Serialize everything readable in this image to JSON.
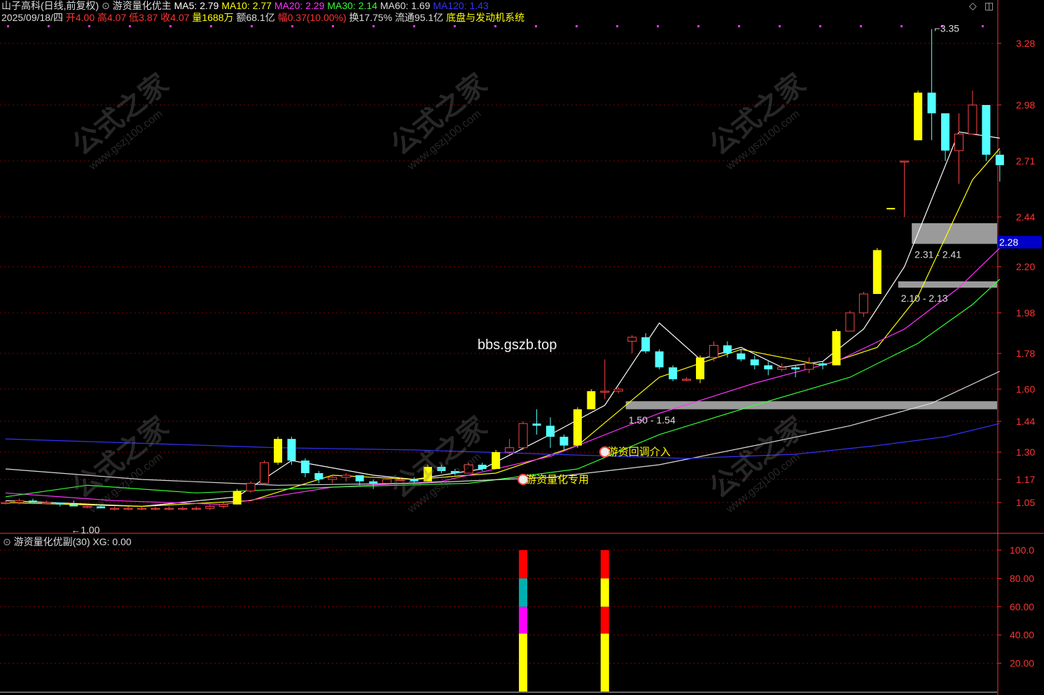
{
  "header": {
    "stock": "山子高科(日线,前复权)",
    "indicator": "游资量化优主",
    "ma": [
      {
        "label": "MA5: 2.79",
        "color": "#ffffff"
      },
      {
        "label": "MA10: 2.77",
        "color": "#ffff00"
      },
      {
        "label": "MA20: 2.29",
        "color": "#ff33ff"
      },
      {
        "label": "MA30: 2.14",
        "color": "#33ff33"
      },
      {
        "label": "MA60: 1.69",
        "color": "#dddddd"
      },
      {
        "label": "MA120: 1.43",
        "color": "#3333ff"
      }
    ],
    "date": "2025/09/18/四",
    "open": "开4.00",
    "high": "高4.07",
    "low": "低3.87",
    "close": "收4.07",
    "volume": "量1688万",
    "amount": "额68.1亿",
    "change": "幅0.37(10.00%)",
    "turnover": "换17.75%",
    "float_cap": "流通95.1亿",
    "system": "底盘与发动机系统"
  },
  "watermark": {
    "cn": "公式之家",
    "url": "www.gszj100.com"
  },
  "site_text": "bbs.gszb.top",
  "price_tag": "2.28",
  "sub_header": {
    "name": "游资量化优副(30)",
    "xg": "XG: 0.00"
  },
  "colors": {
    "up": "#ff4444",
    "down": "#54ffff",
    "signal": "#ffff00",
    "grid": "#8b0000",
    "axis": "#ff3333"
  },
  "chart_data": {
    "type": "candlestick",
    "y_ticks": [
      3.28,
      2.98,
      2.71,
      2.44,
      2.2,
      1.98,
      1.78,
      1.6,
      1.44,
      1.3,
      1.17,
      1.05
    ],
    "y_tick_labels": [
      "3.28",
      "2.98",
      "2.71",
      "2.44",
      "2.20",
      "1.98",
      "1.78",
      "1.60",
      "1.44",
      "1.30",
      "1.17",
      "1.05"
    ],
    "sub_ticks": [
      100,
      80,
      60,
      40,
      20
    ],
    "sub_tick_labels": [
      "100.0",
      "80.00",
      "60.00",
      "40.00",
      "20.00"
    ],
    "candles": [
      [
        1.05,
        1.06,
        1.04,
        1.05
      ],
      [
        1.05,
        1.07,
        1.04,
        1.06
      ],
      [
        1.06,
        1.07,
        1.05,
        1.05
      ],
      [
        1.05,
        1.06,
        1.04,
        1.05
      ],
      [
        1.05,
        1.05,
        1.03,
        1.04
      ],
      [
        1.04,
        1.06,
        1.03,
        1.03
      ],
      [
        1.03,
        1.04,
        1.02,
        1.03
      ],
      [
        1.03,
        1.04,
        1.02,
        1.02
      ],
      [
        1.02,
        1.03,
        1.01,
        1.02
      ],
      [
        1.02,
        1.03,
        1.01,
        1.02
      ],
      [
        1.02,
        1.03,
        1.01,
        1.02
      ],
      [
        1.02,
        1.03,
        1.01,
        1.02
      ],
      [
        1.02,
        1.03,
        1.01,
        1.02
      ],
      [
        1.02,
        1.03,
        1.01,
        1.02
      ],
      [
        1.02,
        1.03,
        1.01,
        1.02
      ],
      [
        1.02,
        1.04,
        1.01,
        1.03
      ],
      [
        1.03,
        1.05,
        1.02,
        1.04
      ],
      [
        1.04,
        1.12,
        1.04,
        1.11
      ],
      [
        1.11,
        1.16,
        1.1,
        1.15
      ],
      [
        1.15,
        1.26,
        1.14,
        1.25
      ],
      [
        1.25,
        1.37,
        1.24,
        1.36
      ],
      [
        1.36,
        1.37,
        1.24,
        1.26
      ],
      [
        1.26,
        1.27,
        1.18,
        1.2
      ],
      [
        1.2,
        1.21,
        1.15,
        1.17
      ],
      [
        1.17,
        1.19,
        1.15,
        1.18
      ],
      [
        1.18,
        1.2,
        1.16,
        1.19
      ],
      [
        1.19,
        1.19,
        1.14,
        1.16
      ],
      [
        1.16,
        1.17,
        1.12,
        1.15
      ],
      [
        1.15,
        1.18,
        1.14,
        1.17
      ],
      [
        1.17,
        1.18,
        1.16,
        1.17
      ],
      [
        1.17,
        1.18,
        1.15,
        1.16
      ],
      [
        1.16,
        1.24,
        1.16,
        1.23
      ],
      [
        1.23,
        1.24,
        1.2,
        1.21
      ],
      [
        1.21,
        1.22,
        1.19,
        1.2
      ],
      [
        1.2,
        1.25,
        1.2,
        1.24
      ],
      [
        1.24,
        1.25,
        1.21,
        1.22
      ],
      [
        1.22,
        1.31,
        1.22,
        1.3
      ],
      [
        1.3,
        1.36,
        1.29,
        1.32
      ],
      [
        1.32,
        1.44,
        1.31,
        1.43
      ],
      [
        1.43,
        1.5,
        1.38,
        1.42
      ],
      [
        1.42,
        1.46,
        1.32,
        1.37
      ],
      [
        1.37,
        1.38,
        1.31,
        1.33
      ],
      [
        1.33,
        1.51,
        1.32,
        1.5
      ],
      [
        1.5,
        1.6,
        1.5,
        1.59
      ],
      [
        1.59,
        1.75,
        1.55,
        1.59
      ],
      [
        1.59,
        1.61,
        1.58,
        1.6
      ],
      [
        1.84,
        1.87,
        1.78,
        1.86
      ],
      [
        1.86,
        1.88,
        1.78,
        1.79
      ],
      [
        1.79,
        1.8,
        1.7,
        1.71
      ],
      [
        1.71,
        1.72,
        1.64,
        1.65
      ],
      [
        1.65,
        1.66,
        1.64,
        1.65
      ],
      [
        1.65,
        1.77,
        1.63,
        1.76
      ],
      [
        1.76,
        1.84,
        1.74,
        1.82
      ],
      [
        1.82,
        1.84,
        1.76,
        1.78
      ],
      [
        1.78,
        1.8,
        1.74,
        1.75
      ],
      [
        1.75,
        1.77,
        1.7,
        1.72
      ],
      [
        1.72,
        1.74,
        1.67,
        1.7
      ],
      [
        1.7,
        1.73,
        1.69,
        1.71
      ],
      [
        1.71,
        1.72,
        1.66,
        1.7
      ],
      [
        1.7,
        1.76,
        1.68,
        1.73
      ],
      [
        1.73,
        1.74,
        1.7,
        1.72
      ],
      [
        1.72,
        1.9,
        1.72,
        1.89
      ],
      [
        1.89,
        1.99,
        1.89,
        1.98
      ],
      [
        1.98,
        2.08,
        1.96,
        2.07
      ],
      [
        2.07,
        2.29,
        2.07,
        2.28
      ],
      [
        2.48,
        2.48,
        2.48,
        2.48
      ],
      [
        2.71,
        2.71,
        2.44,
        2.71
      ],
      [
        2.81,
        3.05,
        2.81,
        3.04
      ],
      [
        3.04,
        3.35,
        2.81,
        2.94
      ],
      [
        2.94,
        2.94,
        2.71,
        2.76
      ],
      [
        2.76,
        2.94,
        2.6,
        2.84
      ],
      [
        2.84,
        3.05,
        2.84,
        2.98
      ],
      [
        2.98,
        2.98,
        2.71,
        2.74
      ],
      [
        2.74,
        2.76,
        2.61,
        2.69
      ]
    ],
    "ma_series": [
      {
        "name": "MA5",
        "color": "#ffffff",
        "values": [
          [
            0,
            1.06
          ],
          [
            10,
            1.03
          ],
          [
            17,
            1.08
          ],
          [
            21,
            1.26
          ],
          [
            27,
            1.19
          ],
          [
            30,
            1.17
          ],
          [
            35,
            1.22
          ],
          [
            40,
            1.38
          ],
          [
            44,
            1.52
          ],
          [
            48,
            1.93
          ],
          [
            51,
            1.75
          ],
          [
            54,
            1.81
          ],
          [
            57,
            1.71
          ],
          [
            60,
            1.74
          ],
          [
            63,
            1.9
          ],
          [
            66,
            2.2
          ],
          [
            70,
            2.85
          ],
          [
            73,
            2.82
          ]
        ]
      },
      {
        "name": "MA10",
        "color": "#ffff00",
        "values": [
          [
            0,
            1.05
          ],
          [
            10,
            1.03
          ],
          [
            18,
            1.06
          ],
          [
            24,
            1.19
          ],
          [
            30,
            1.17
          ],
          [
            36,
            1.2
          ],
          [
            42,
            1.33
          ],
          [
            48,
            1.66
          ],
          [
            54,
            1.8
          ],
          [
            60,
            1.72
          ],
          [
            64,
            1.81
          ],
          [
            67,
            2.06
          ],
          [
            71,
            2.62
          ],
          [
            73,
            2.77
          ]
        ]
      },
      {
        "name": "MA20",
        "color": "#ff33ff",
        "values": [
          [
            0,
            1.1
          ],
          [
            8,
            1.06
          ],
          [
            16,
            1.04
          ],
          [
            24,
            1.13
          ],
          [
            32,
            1.16
          ],
          [
            40,
            1.28
          ],
          [
            48,
            1.48
          ],
          [
            55,
            1.63
          ],
          [
            61,
            1.74
          ],
          [
            66,
            1.9
          ],
          [
            70,
            2.1
          ],
          [
            73,
            2.29
          ]
        ]
      },
      {
        "name": "MA30",
        "color": "#33ff33",
        "values": [
          [
            0,
            1.08
          ],
          [
            6,
            1.14
          ],
          [
            14,
            1.1
          ],
          [
            24,
            1.13
          ],
          [
            34,
            1.15
          ],
          [
            42,
            1.22
          ],
          [
            48,
            1.38
          ],
          [
            55,
            1.52
          ],
          [
            62,
            1.66
          ],
          [
            67,
            1.83
          ],
          [
            71,
            2.02
          ],
          [
            73,
            2.14
          ]
        ]
      },
      {
        "name": "MA60",
        "color": "#dddddd",
        "values": [
          [
            0,
            1.22
          ],
          [
            10,
            1.17
          ],
          [
            20,
            1.14
          ],
          [
            30,
            1.15
          ],
          [
            40,
            1.18
          ],
          [
            48,
            1.24
          ],
          [
            55,
            1.33
          ],
          [
            62,
            1.42
          ],
          [
            68,
            1.53
          ],
          [
            73,
            1.69
          ]
        ]
      },
      {
        "name": "MA120",
        "color": "#3333ff",
        "values": [
          [
            0,
            1.36
          ],
          [
            10,
            1.34
          ],
          [
            20,
            1.32
          ],
          [
            30,
            1.31
          ],
          [
            40,
            1.29
          ],
          [
            50,
            1.27
          ],
          [
            58,
            1.29
          ],
          [
            64,
            1.33
          ],
          [
            69,
            1.37
          ],
          [
            73,
            1.43
          ]
        ]
      }
    ],
    "zones": [
      {
        "label": "1.50 - 1.54",
        "low": 1.5,
        "high": 1.54,
        "start": 46
      },
      {
        "label": "2.10 - 2.13",
        "low": 2.1,
        "high": 2.13,
        "start": 66
      },
      {
        "label": "2.31 - 2.41",
        "low": 2.31,
        "high": 2.41,
        "start": 67
      }
    ],
    "annotations": [
      {
        "text": "游资量化专用",
        "index": 38,
        "price": 1.19
      },
      {
        "text": "游资回调介入",
        "index": 44,
        "price": 1.32
      }
    ],
    "price_marks": [
      {
        "text": "3.35",
        "index": 68,
        "price": 3.35
      },
      {
        "text": "←1.00",
        "index": 5,
        "price": 1.0
      }
    ],
    "sub_bars": [
      {
        "index": 38,
        "segments": [
          [
            0,
            41,
            "#ffff00"
          ],
          [
            41,
            60,
            "#ff00ff"
          ],
          [
            60,
            80,
            "#00b0b0"
          ],
          [
            80,
            100,
            "#ff0000"
          ]
        ]
      },
      {
        "index": 44,
        "segments": [
          [
            0,
            41,
            "#ffff00"
          ],
          [
            41,
            60,
            "#ff0000"
          ],
          [
            60,
            80,
            "#ffff00"
          ],
          [
            80,
            100,
            "#ff0000"
          ]
        ]
      }
    ]
  }
}
